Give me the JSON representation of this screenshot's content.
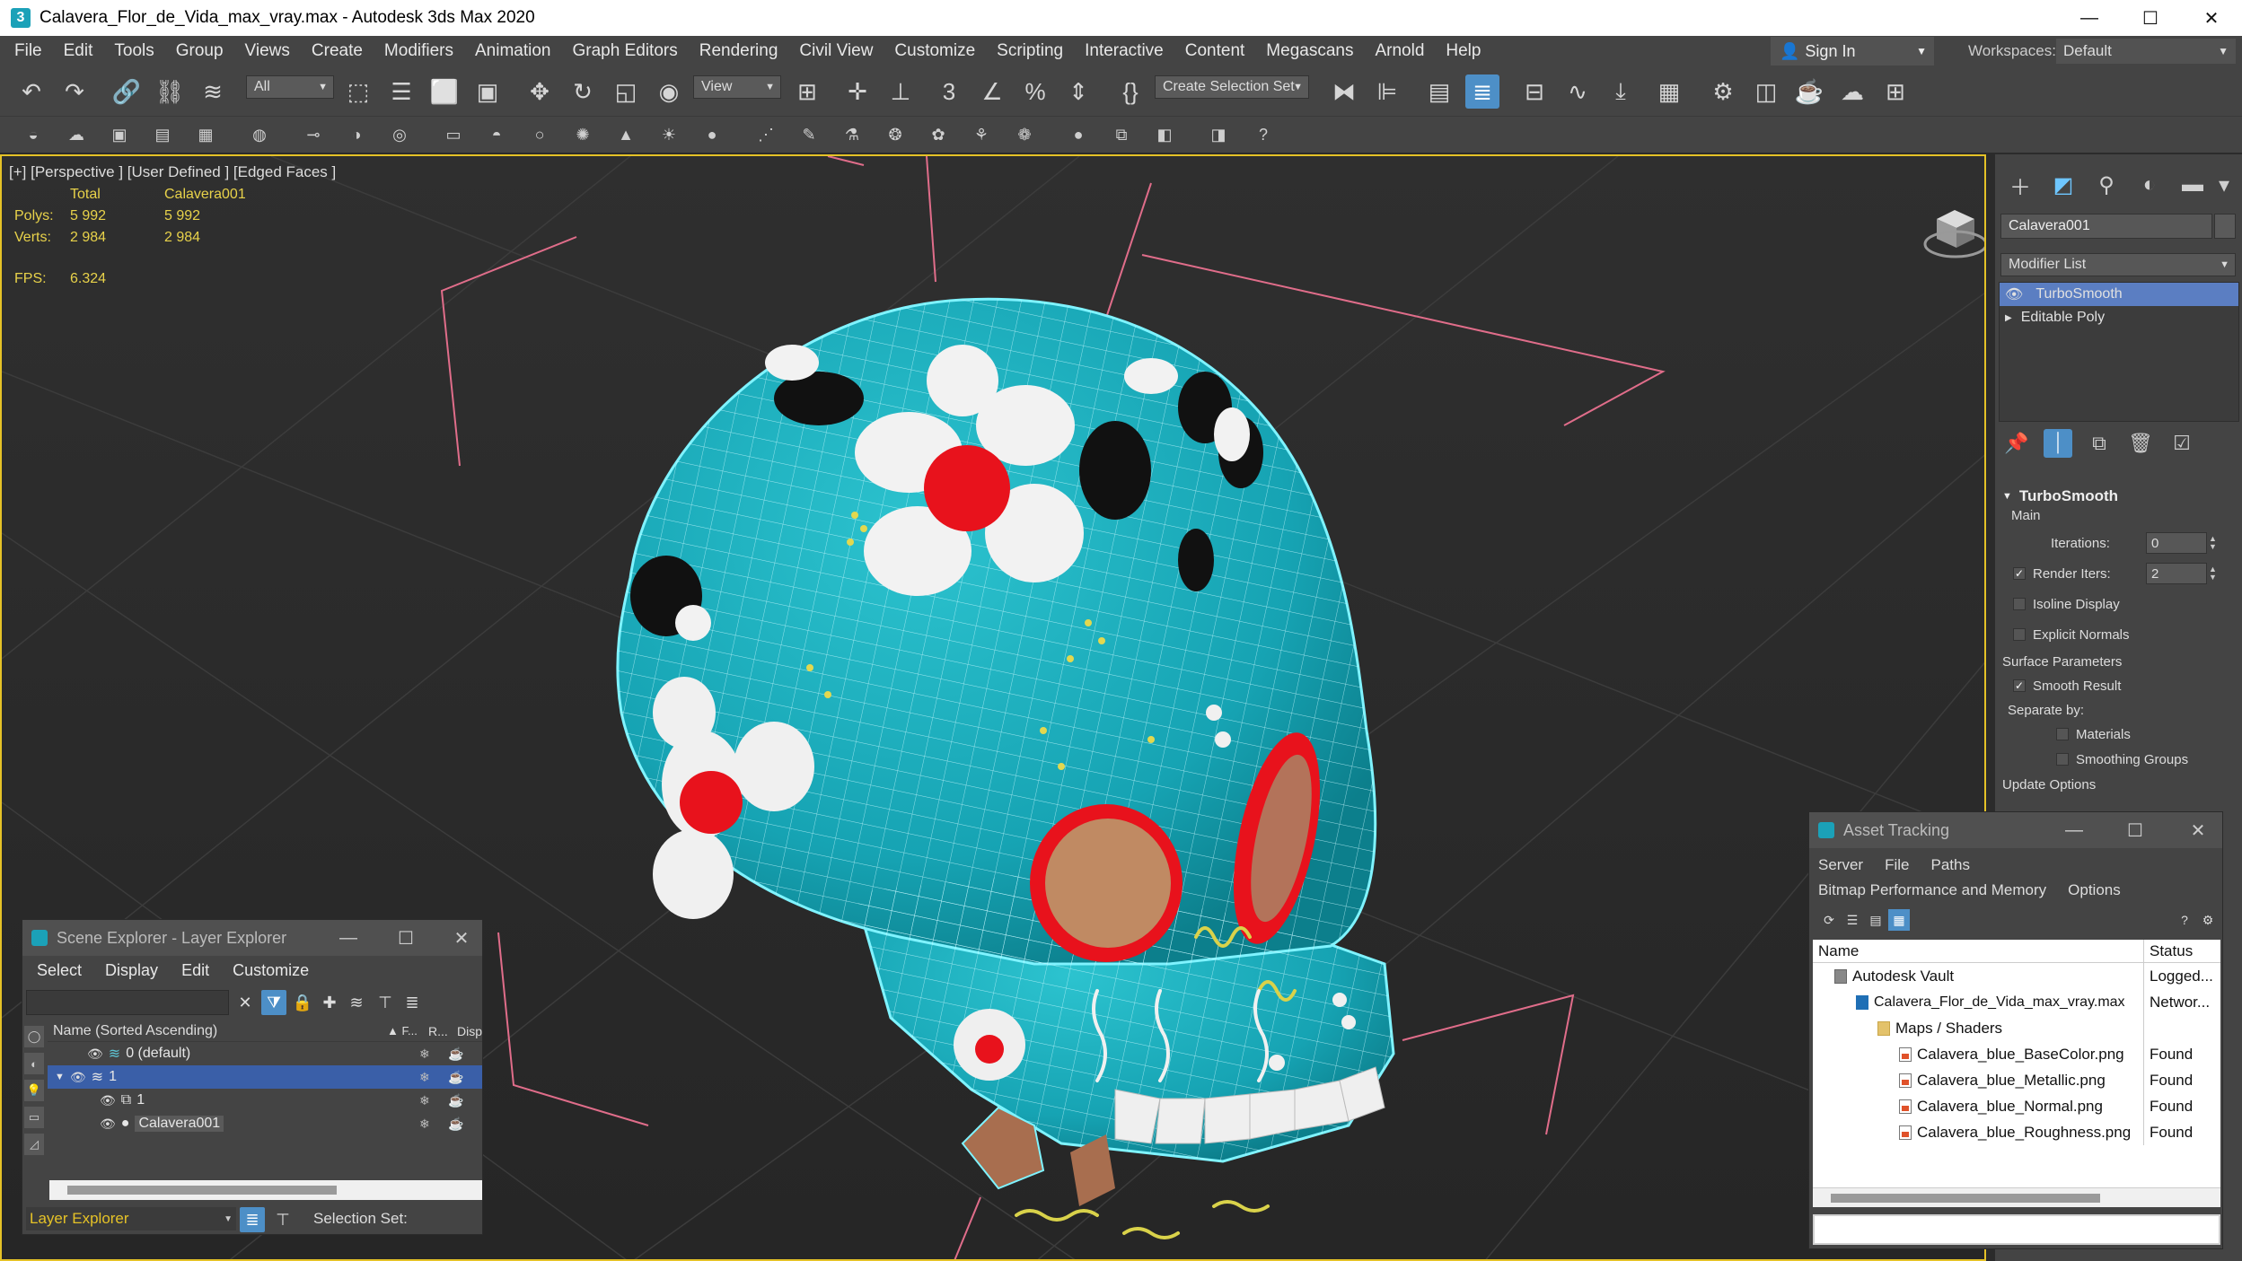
{
  "window": {
    "title": "Calavera_Flor_de_Vida_max_vray.max - Autodesk 3ds Max 2020",
    "app_icon": "3",
    "minimize": "—",
    "maximize": "☐",
    "close": "✕"
  },
  "menubar": {
    "items": [
      "File",
      "Edit",
      "Tools",
      "Group",
      "Views",
      "Create",
      "Modifiers",
      "Animation",
      "Graph Editors",
      "Rendering",
      "Civil View",
      "Customize",
      "Scripting",
      "Interactive",
      "Content",
      "Megascans",
      "Arnold",
      "Help"
    ],
    "sign_in": "Sign In",
    "workspaces_label": "Workspaces:",
    "workspace_value": "Default"
  },
  "toolbar": {
    "filter_value": "All",
    "ref_coord_value": "View",
    "selection_set_placeholder": "Create Selection Set"
  },
  "viewport": {
    "label": "[+] [Perspective ] [User Defined ] [Edged Faces ]",
    "stats": {
      "header_total": "Total",
      "header_object": "Calavera001",
      "polys_label": "Polys:",
      "polys_total": "5 992",
      "polys_object": "5 992",
      "verts_label": "Verts:",
      "verts_total": "2 984",
      "verts_object": "2 984",
      "fps_label": "FPS:",
      "fps_value": "6.324"
    },
    "colors": {
      "skull_teal": "#19a9b8",
      "wire": "#7ff3ff",
      "active_border": "#e5c227",
      "bbox": "#e06d8a"
    }
  },
  "command_panel": {
    "object_name": "Calavera001",
    "modifier_list": "Modifier List",
    "stack": [
      "TurboSmooth",
      "Editable Poly"
    ],
    "rollout": {
      "title": "TurboSmooth",
      "main": "Main",
      "iterations_label": "Iterations:",
      "iterations_value": "0",
      "render_iters_label": "Render Iters:",
      "render_iters_value": "2",
      "isoline_display": "Isoline Display",
      "explicit_normals": "Explicit Normals",
      "surface_parameters": "Surface Parameters",
      "smooth_result": "Smooth Result",
      "separate_by": "Separate by:",
      "materials": "Materials",
      "smoothing_groups": "Smoothing Groups",
      "update_options": "Update Options"
    }
  },
  "scene_explorer": {
    "title": "Scene Explorer - Layer Explorer",
    "menu": [
      "Select",
      "Display",
      "Edit",
      "Customize"
    ],
    "column_name": "Name (Sorted Ascending)",
    "column_f": "▲ F...",
    "column_r": "R...",
    "column_disp": "Disp",
    "rows": [
      "0 (default)",
      "1",
      "1",
      "Calavera001"
    ],
    "layer_explorer": "Layer Explorer",
    "selection_set": "Selection Set:"
  },
  "asset_tracking": {
    "title": "Asset Tracking",
    "menu1": [
      "Server",
      "File",
      "Paths"
    ],
    "menu2": [
      "Bitmap Performance and Memory",
      "Options"
    ],
    "col_name": "Name",
    "col_status": "Status",
    "rows": [
      {
        "name": "Autodesk Vault",
        "status": "Logged..."
      },
      {
        "name": "Calavera_Flor_de_Vida_max_vray.max",
        "status": "Networ..."
      },
      {
        "name": "Maps / Shaders",
        "status": ""
      },
      {
        "name": "Calavera_blue_BaseColor.png",
        "status": "Found"
      },
      {
        "name": "Calavera_blue_Metallic.png",
        "status": "Found"
      },
      {
        "name": "Calavera_blue_Normal.png",
        "status": "Found"
      },
      {
        "name": "Calavera_blue_Roughness.png",
        "status": "Found"
      }
    ]
  }
}
